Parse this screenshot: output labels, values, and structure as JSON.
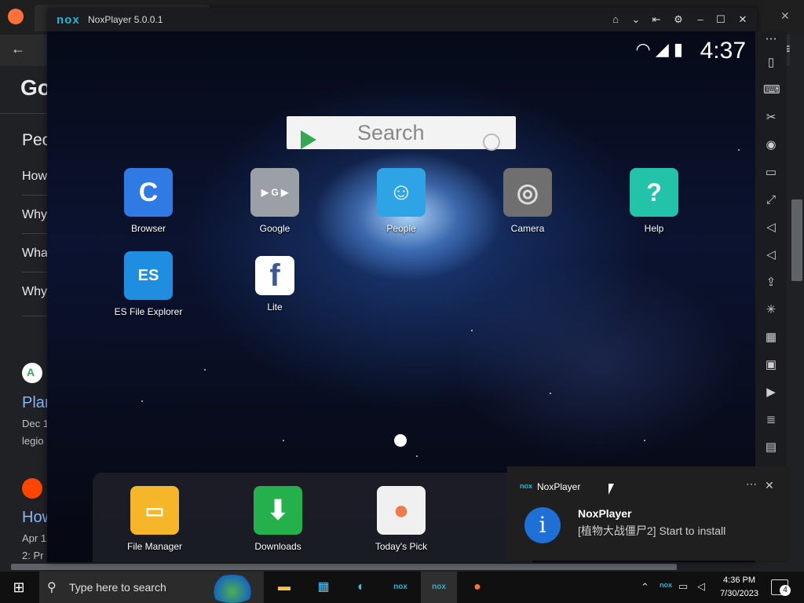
{
  "nox": {
    "logo": "nox",
    "title": "NoxPlayer 5.0.0.1",
    "window_buttons": {
      "home": "⌂",
      "collapse": "⌄",
      "pin": "⇤",
      "settings": "⚙",
      "minimize": "–",
      "maximize": "☐",
      "close": "✕"
    }
  },
  "status": {
    "time": "4:37",
    "icons": "▼◢ ▮"
  },
  "search": {
    "placeholder": "Search"
  },
  "apps": [
    {
      "label": "Browser",
      "icon": "browser-icon",
      "color": "#2f7be3"
    },
    {
      "label": "Google",
      "icon": "google-folder-icon",
      "color": "#9aa0a6"
    },
    {
      "label": "People",
      "icon": "people-icon",
      "color": "#2ea4e6"
    },
    {
      "label": "Camera",
      "icon": "camera-icon",
      "color": "#6f6f6f"
    },
    {
      "label": "Help",
      "icon": "help-icon",
      "color": "#22c3a8"
    },
    {
      "label": "ES File Explorer",
      "icon": "es-file-explorer-icon",
      "color": "#1f8de0"
    },
    {
      "label": "Lite",
      "icon": "facebook-lite-icon",
      "color": "#ffffff"
    }
  ],
  "dock": [
    {
      "label": "File Manager",
      "icon": "folder-icon",
      "color": "#f6b62a"
    },
    {
      "label": "Downloads",
      "icon": "download-icon",
      "color": "#24b04b"
    },
    {
      "label": "Today's Pick",
      "icon": "balloons-icon",
      "color": "#f0f0f0"
    }
  ],
  "toast": {
    "app": "NoxPlayer",
    "heading": "NoxPlayer",
    "body": "[植物大战僵尸2] Start to install"
  },
  "browser": {
    "logo_partial": "Go",
    "heading_partial": "Peo",
    "questions": [
      "How",
      "Why",
      "Wha",
      "Why"
    ],
    "result1_title": "Plan",
    "result1_date": "Dec 1",
    "result1_snip": "legio",
    "result2_title": "How",
    "result2_date": "Apr 1",
    "result2_snip": "2: Pr"
  },
  "taskbar": {
    "search_placeholder": "Type here to search",
    "time": "4:36 PM",
    "date": "7/30/2023",
    "notifications": "4"
  }
}
